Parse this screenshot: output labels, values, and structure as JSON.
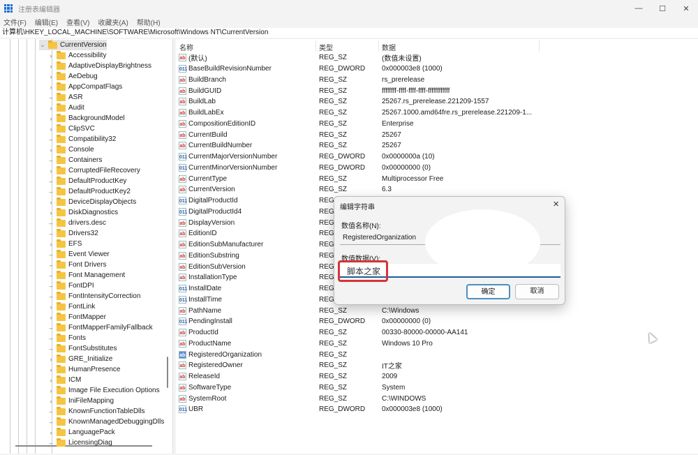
{
  "window": {
    "title": "注册表编辑器"
  },
  "menu": [
    "文件(F)",
    "编辑(E)",
    "查看(V)",
    "收藏夹(A)",
    "帮助(H)"
  ],
  "address": "计算机\\HKEY_LOCAL_MACHINE\\SOFTWARE\\Microsoft\\Windows NT\\CurrentVersion",
  "tree": {
    "current": "CurrentVersion",
    "children": [
      {
        "name": "Accessibility",
        "exp": true
      },
      {
        "name": "AdaptiveDisplayBrightness",
        "exp": true
      },
      {
        "name": "AeDebug",
        "exp": true
      },
      {
        "name": "AppCompatFlags",
        "exp": true
      },
      {
        "name": "ASR",
        "exp": false
      },
      {
        "name": "Audit",
        "exp": true
      },
      {
        "name": "BackgroundModel",
        "exp": true
      },
      {
        "name": "ClipSVC",
        "exp": true
      },
      {
        "name": "Compatibility32",
        "exp": false
      },
      {
        "name": "Console",
        "exp": true
      },
      {
        "name": "Containers",
        "exp": false
      },
      {
        "name": "CorruptedFileRecovery",
        "exp": true
      },
      {
        "name": "DefaultProductKey",
        "exp": false
      },
      {
        "name": "DefaultProductKey2",
        "exp": false
      },
      {
        "name": "DeviceDisplayObjects",
        "exp": true
      },
      {
        "name": "DiskDiagnostics",
        "exp": true
      },
      {
        "name": "drivers.desc",
        "exp": false
      },
      {
        "name": "Drivers32",
        "exp": false
      },
      {
        "name": "EFS",
        "exp": true
      },
      {
        "name": "Event Viewer",
        "exp": false
      },
      {
        "name": "Font Drivers",
        "exp": false
      },
      {
        "name": "Font Management",
        "exp": false
      },
      {
        "name": "FontDPI",
        "exp": false
      },
      {
        "name": "FontIntensityCorrection",
        "exp": false
      },
      {
        "name": "FontLink",
        "exp": true
      },
      {
        "name": "FontMapper",
        "exp": true
      },
      {
        "name": "FontMapperFamilyFallback",
        "exp": false
      },
      {
        "name": "Fonts",
        "exp": false
      },
      {
        "name": "FontSubstitutes",
        "exp": false
      },
      {
        "name": "GRE_Initialize",
        "exp": true
      },
      {
        "name": "HumanPresence",
        "exp": true
      },
      {
        "name": "ICM",
        "exp": true
      },
      {
        "name": "Image File Execution Options",
        "exp": true
      },
      {
        "name": "IniFileMapping",
        "exp": true
      },
      {
        "name": "KnownFunctionTableDlls",
        "exp": false
      },
      {
        "name": "KnownManagedDebuggingDlls",
        "exp": false
      },
      {
        "name": "LanguagePack",
        "exp": true
      },
      {
        "name": "LicensingDiag",
        "exp": false
      }
    ]
  },
  "list": {
    "headers": {
      "name": "名称",
      "type": "类型",
      "data": "数据"
    },
    "rows": [
      {
        "icon": "ab",
        "name": "(默认)",
        "type": "REG_SZ",
        "data": "(数值未设置)"
      },
      {
        "icon": "bin",
        "name": "BaseBuildRevisionNumber",
        "type": "REG_DWORD",
        "data": "0x000003e8 (1000)"
      },
      {
        "icon": "ab",
        "name": "BuildBranch",
        "type": "REG_SZ",
        "data": "rs_prerelease"
      },
      {
        "icon": "ab",
        "name": "BuildGUID",
        "type": "REG_SZ",
        "data": "ffffffff-ffff-ffff-ffff-ffffffffffff"
      },
      {
        "icon": "ab",
        "name": "BuildLab",
        "type": "REG_SZ",
        "data": "25267.rs_prerelease.221209-1557"
      },
      {
        "icon": "ab",
        "name": "BuildLabEx",
        "type": "REG_SZ",
        "data": "25267.1000.amd64fre.rs_prerelease.221209-1..."
      },
      {
        "icon": "ab",
        "name": "CompositionEditionID",
        "type": "REG_SZ",
        "data": "Enterprise"
      },
      {
        "icon": "ab",
        "name": "CurrentBuild",
        "type": "REG_SZ",
        "data": "25267"
      },
      {
        "icon": "ab",
        "name": "CurrentBuildNumber",
        "type": "REG_SZ",
        "data": "25267"
      },
      {
        "icon": "bin",
        "name": "CurrentMajorVersionNumber",
        "type": "REG_DWORD",
        "data": "0x0000000a (10)"
      },
      {
        "icon": "bin",
        "name": "CurrentMinorVersionNumber",
        "type": "REG_DWORD",
        "data": "0x00000000 (0)"
      },
      {
        "icon": "ab",
        "name": "CurrentType",
        "type": "REG_SZ",
        "data": "Multiprocessor Free"
      },
      {
        "icon": "ab",
        "name": "CurrentVersion",
        "type": "REG_SZ",
        "data": "6.3"
      },
      {
        "icon": "bin",
        "name": "DigitalProductId",
        "type": "REG_",
        "data": ""
      },
      {
        "icon": "bin",
        "name": "DigitalProductId4",
        "type": "REG_",
        "data": ""
      },
      {
        "icon": "ab",
        "name": "DisplayVersion",
        "type": "REG_",
        "data": ""
      },
      {
        "icon": "ab",
        "name": "EditionID",
        "type": "REG_",
        "data": ""
      },
      {
        "icon": "ab",
        "name": "EditionSubManufacturer",
        "type": "REG_",
        "data": ""
      },
      {
        "icon": "ab",
        "name": "EditionSubstring",
        "type": "REG_",
        "data": ""
      },
      {
        "icon": "ab",
        "name": "EditionSubVersion",
        "type": "REG_",
        "data": ""
      },
      {
        "icon": "ab",
        "name": "InstallationType",
        "type": "REG_",
        "data": ""
      },
      {
        "icon": "bin",
        "name": "InstallDate",
        "type": "REG_",
        "data": ""
      },
      {
        "icon": "bin",
        "name": "InstallTime",
        "type": "REG_",
        "data": ""
      },
      {
        "icon": "ab",
        "name": "PathName",
        "type": "REG_SZ",
        "data": "C:\\Windows"
      },
      {
        "icon": "bin",
        "name": "PendingInstall",
        "type": "REG_DWORD",
        "data": "0x00000000 (0)"
      },
      {
        "icon": "ab",
        "name": "ProductId",
        "type": "REG_SZ",
        "data": "00330-80000-00000-AA141"
      },
      {
        "icon": "ab",
        "name": "ProductName",
        "type": "REG_SZ",
        "data": "Windows 10 Pro"
      },
      {
        "icon": "ab",
        "name": "RegisteredOrganization",
        "type": "REG_SZ",
        "data": "",
        "selected": true
      },
      {
        "icon": "ab",
        "name": "RegisteredOwner",
        "type": "REG_SZ",
        "data": "IT之家"
      },
      {
        "icon": "ab",
        "name": "ReleaseId",
        "type": "REG_SZ",
        "data": "2009"
      },
      {
        "icon": "ab",
        "name": "SoftwareType",
        "type": "REG_SZ",
        "data": "System"
      },
      {
        "icon": "ab",
        "name": "SystemRoot",
        "type": "REG_SZ",
        "data": "C:\\WINDOWS"
      },
      {
        "icon": "bin",
        "name": "UBR",
        "type": "REG_DWORD",
        "data": "0x000003e8 (1000)"
      }
    ]
  },
  "dialog": {
    "title": "编辑字符串",
    "name_label": "数值名称(N):",
    "name_value": "RegisteredOrganization",
    "data_label": "数值数据(V):",
    "data_value": "脚本之家",
    "ok": "确定",
    "cancel": "取消"
  }
}
